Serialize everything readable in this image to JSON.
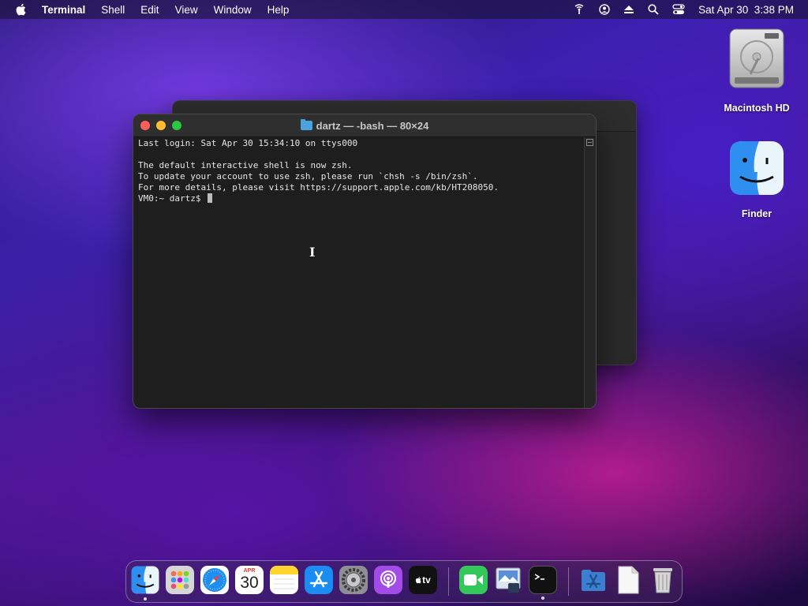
{
  "menubar": {
    "app_name": "Terminal",
    "menus": [
      "Shell",
      "Edit",
      "View",
      "Window",
      "Help"
    ],
    "clock": "Sat Apr 30  3:38 PM",
    "status_icons": [
      "network-icon",
      "user-icon",
      "eject-icon",
      "search-icon",
      "control-center-icon"
    ]
  },
  "desktop": {
    "icons": [
      {
        "label": "Macintosh HD",
        "icon": "hard-drive-icon"
      },
      {
        "label": "Finder",
        "icon": "finder-icon"
      }
    ]
  },
  "terminal": {
    "title": "dartz — -bash — 80×24",
    "lines": [
      "Last login: Sat Apr 30 15:34:10 on ttys000",
      "",
      "The default interactive shell is now zsh.",
      "To update your account to use zsh, please run `chsh -s /bin/zsh`.",
      "For more details, please visit https://support.apple.com/kb/HT208050."
    ],
    "prompt": "VM0:~ dartz$ "
  },
  "dock": {
    "calendar_month": "APR",
    "calendar_day": "30",
    "tv_label": "tv",
    "items": [
      "finder-icon",
      "launchpad-icon",
      "safari-icon",
      "calendar-icon",
      "notes-icon",
      "app-store-icon",
      "system-preferences-icon",
      "podcasts-icon",
      "apple-tv-icon",
      "facetime-icon",
      "preview-icon",
      "terminal-icon",
      "applications-folder-icon",
      "document-icon",
      "trash-icon"
    ]
  }
}
